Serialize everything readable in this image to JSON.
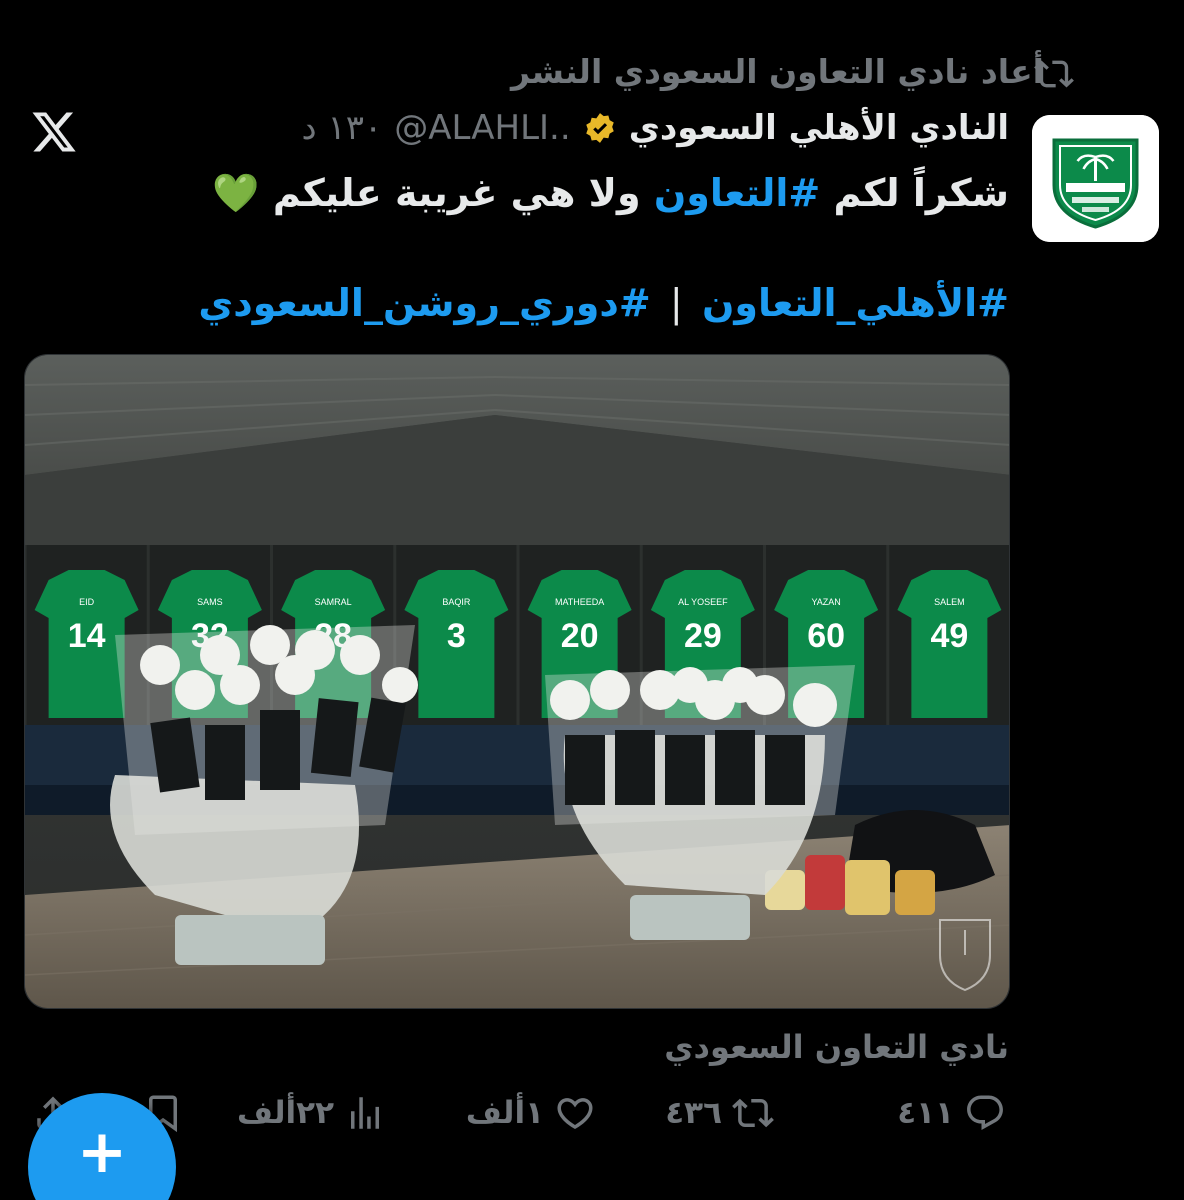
{
  "retweet": {
    "text": "أعاد نادي التعاون السعودي النشر"
  },
  "author": {
    "name": "النادي الأهلي السعودي",
    "handle": "@ALAHLI..",
    "time": "١٣٠ د",
    "verified": true
  },
  "tweet": {
    "line1_part1": "شكراً لكم ",
    "line1_hashtag": "#التعاون",
    "line1_part2": " ولا هي غريبة عليكم",
    "emoji": "💚",
    "hashtag_a": "#الأهلي_التعاون",
    "separator": "|",
    "hashtag_b": "#دوري_روشن_السعودي"
  },
  "media": {
    "jerseys": [
      {
        "name": "EID",
        "number": "14"
      },
      {
        "name": "SAMS",
        "number": "32"
      },
      {
        "name": "SAMRAL",
        "number": "28"
      },
      {
        "name": "BAQIR",
        "number": "3"
      },
      {
        "name": "MATHEEDA",
        "number": "20"
      },
      {
        "name": "AL YOSEEF",
        "number": "29"
      },
      {
        "name": "YAZAN",
        "number": "60"
      },
      {
        "name": "SALEM",
        "number": "49"
      }
    ]
  },
  "source": "نادي التعاون السعودي",
  "actions": {
    "replies": "٤١١",
    "retweets": "٤٣٦",
    "likes": "١ألف",
    "views": "٢٢ألف"
  },
  "colors": {
    "accent": "#1d9bf0",
    "muted": "#71767b",
    "text": "#e7e9ea",
    "club_green": "#0c8a4a"
  }
}
